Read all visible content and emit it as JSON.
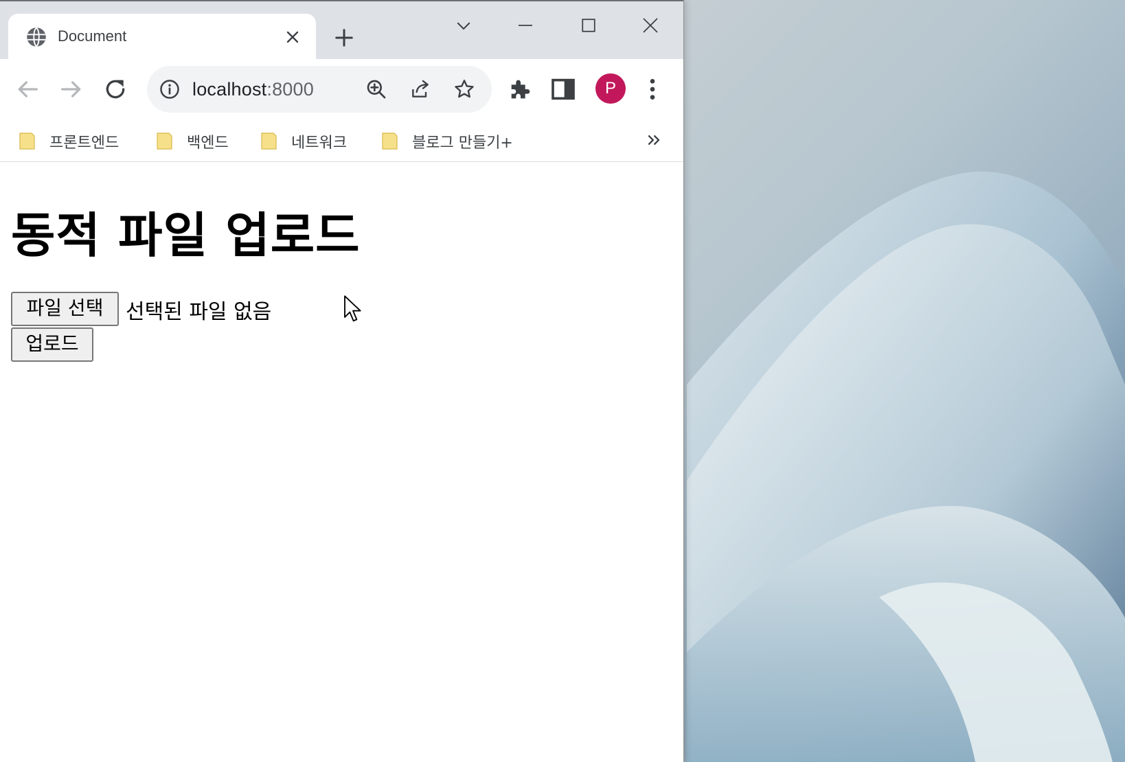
{
  "browser": {
    "tab": {
      "title": "Document",
      "favicon": "globe-icon"
    },
    "new_tab_icon": "plus-icon",
    "window_controls": [
      "chevron-down-icon",
      "minimize-icon",
      "maximize-icon",
      "close-icon"
    ],
    "address": {
      "host": "localhost",
      "port": ":8000"
    },
    "profile_initial": "P",
    "profile_color": "#c2185b",
    "bookmarks": [
      {
        "label": "프론트엔드"
      },
      {
        "label": "백엔드"
      },
      {
        "label": "네트워크"
      },
      {
        "label": "블로그 만들기+"
      }
    ]
  },
  "page": {
    "heading": "동적 파일 업로드",
    "file_button_label": "파일 선택",
    "file_status": "선택된 파일 없음",
    "upload_button_label": "업로드"
  }
}
